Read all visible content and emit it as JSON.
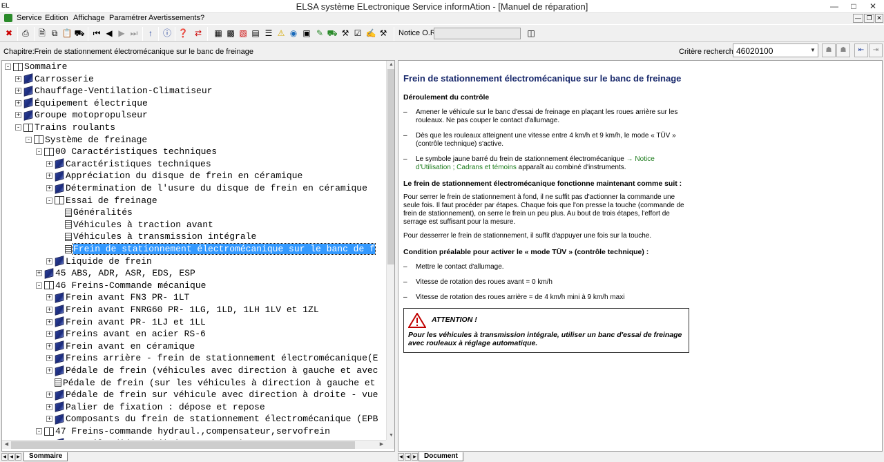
{
  "window": {
    "title": "ELSA système ELectronique Service informAtion - [Manuel de réparation]",
    "app_icon": "EL"
  },
  "menu": [
    "Service",
    "Edition",
    "Affichage",
    "Paramétrer",
    "Avertissements",
    "?"
  ],
  "toolbar": {
    "notice_label": "Notice O.R.:",
    "notice_value": ""
  },
  "chapter": {
    "text": "Chapitre:Frein de stationnement électromécanique sur le banc de freinage"
  },
  "search": {
    "label": "Critère recherche:",
    "value": "46020100"
  },
  "tree": [
    {
      "label": "Sommaire",
      "level": 0,
      "exp": "-",
      "icon": "book-open"
    },
    {
      "label": "Carrosserie",
      "level": 1,
      "exp": "+",
      "icon": "book-closed"
    },
    {
      "label": "Chauffage-Ventilation-Climatiseur",
      "level": 1,
      "exp": "+",
      "icon": "book-closed"
    },
    {
      "label": "Équipement électrique",
      "level": 1,
      "exp": "+",
      "icon": "book-closed"
    },
    {
      "label": "Groupe motopropulseur",
      "level": 1,
      "exp": "+",
      "icon": "book-closed"
    },
    {
      "label": "Trains roulants",
      "level": 1,
      "exp": "-",
      "icon": "book-open"
    },
    {
      "label": "Système de freinage",
      "level": 2,
      "exp": "-",
      "icon": "book-open"
    },
    {
      "label": "00 Caractéristiques techniques",
      "level": 3,
      "exp": "-",
      "icon": "book-open"
    },
    {
      "label": "Caractéristiques techniques",
      "level": 4,
      "exp": "+",
      "icon": "book-closed"
    },
    {
      "label": "Appréciation du disque de frein en céramique",
      "level": 4,
      "exp": "+",
      "icon": "book-closed"
    },
    {
      "label": "Détermination de l'usure du disque de frein en céramique",
      "level": 4,
      "exp": "+",
      "icon": "book-closed"
    },
    {
      "label": "Essai de freinage",
      "level": 4,
      "exp": "-",
      "icon": "book-open"
    },
    {
      "label": "Généralités",
      "level": 5,
      "exp": "",
      "icon": "doc"
    },
    {
      "label": "Véhicules à traction avant",
      "level": 5,
      "exp": "",
      "icon": "doc"
    },
    {
      "label": "Véhicules à transmission intégrale",
      "level": 5,
      "exp": "",
      "icon": "doc"
    },
    {
      "label": "Frein de stationnement électromécanique sur le banc de f",
      "level": 5,
      "exp": "",
      "icon": "doc",
      "selected": true
    },
    {
      "label": "Liquide de frein",
      "level": 4,
      "exp": "+",
      "icon": "book-closed"
    },
    {
      "label": "45 ABS, ADR, ASR, EDS, ESP",
      "level": 3,
      "exp": "+",
      "icon": "book-closed"
    },
    {
      "label": "46 Freins-Commande mécanique",
      "level": 3,
      "exp": "-",
      "icon": "book-open"
    },
    {
      "label": "Frein avant FN3 PR- 1LT",
      "level": 4,
      "exp": "+",
      "icon": "book-closed"
    },
    {
      "label": "Frein avant FNRG60 PR- 1LG, 1LD, 1LH 1LV et 1ZL",
      "level": 4,
      "exp": "+",
      "icon": "book-closed"
    },
    {
      "label": "Frein avant PR- 1LJ et 1LL",
      "level": 4,
      "exp": "+",
      "icon": "book-closed"
    },
    {
      "label": "Freins avant en acier RS-6",
      "level": 4,
      "exp": "+",
      "icon": "book-closed"
    },
    {
      "label": "Frein avant en céramique",
      "level": 4,
      "exp": "+",
      "icon": "book-closed"
    },
    {
      "label": "Freins arrière - frein de stationnement électromécanique(E",
      "level": 4,
      "exp": "+",
      "icon": "book-closed"
    },
    {
      "label": "Pédale de frein (véhicules avec direction à gauche et avec",
      "level": 4,
      "exp": "+",
      "icon": "book-closed"
    },
    {
      "label": "Pédale de frein (sur les véhicules à direction à gauche et",
      "level": 4,
      "exp": "",
      "icon": "doc"
    },
    {
      "label": "Pédale de frein sur véhicule avec direction à droite - vue",
      "level": 4,
      "exp": "+",
      "icon": "book-closed"
    },
    {
      "label": "Palier de fixation : dépose et repose",
      "level": 4,
      "exp": "+",
      "icon": "book-closed"
    },
    {
      "label": "Composants du frein de stationnement électromécanique (EPB",
      "level": 4,
      "exp": "+",
      "icon": "book-closed"
    },
    {
      "label": "47 Freins-commande hydraul.,compensateur,servofrein",
      "level": 3,
      "exp": "-",
      "icon": "book-open"
    },
    {
      "label": "Contrôle d'étanchéité sous pression",
      "level": 4,
      "exp": "+",
      "icon": "book-closed"
    }
  ],
  "tabs": {
    "left": "Sommaire",
    "right": "Document"
  },
  "doc": {
    "title": "Frein de stationnement électromécanique sur le banc de freinage",
    "h1": "Déroulement du contrôle",
    "li1": "Amener le véhicule sur le banc d'essai de freinage en plaçant les roues arrière sur les rouleaux. Ne pas couper le contact d'allumage.",
    "li2": "Dès que les rouleaux atteignent une vitesse entre 4 km/h et 9 km/h, le mode « TÜV » (contrôle technique) s'active.",
    "li3_a": "Le symbole jaune barré du frein de stationnement électromécanique ",
    "li3_link": "→ Notice d'Utilisation ; Cadrans et témoins",
    "li3_b": " apparaît au combiné d'instruments.",
    "h2": "Le frein de stationnement électromécanique fonctionne maintenant comme suit :",
    "p1": "Pour serrer le frein de stationnement à fond, il ne suffit pas d'actionner la commande une seule fois. Il faut procéder par étapes. Chaque fois que l'on presse la touche (commande de frein de stationnement), on serre le frein un peu plus. Au bout de trois étapes, l'effort de serrage est suffisant pour la mesure.",
    "p2": "Pour desserrer le frein de stationnement, il suffit d'appuyer une fois sur la touche.",
    "h3": "Condition préalable pour activer le « mode TÜV » (contrôle technique) :",
    "li4": "Mettre le contact d'allumage.",
    "li5": "Vitesse de rotation des roues avant = 0 km/h",
    "li6": "Vitesse de rotation des roues arrière = de 4 km/h mini à 9 km/h maxi",
    "attention_title": "ATTENTION !",
    "attention_text": "Pour les véhicules à transmission intégrale, utiliser un banc d'essai de freinage avec rouleaux à réglage automatique.",
    "dash": "–"
  }
}
